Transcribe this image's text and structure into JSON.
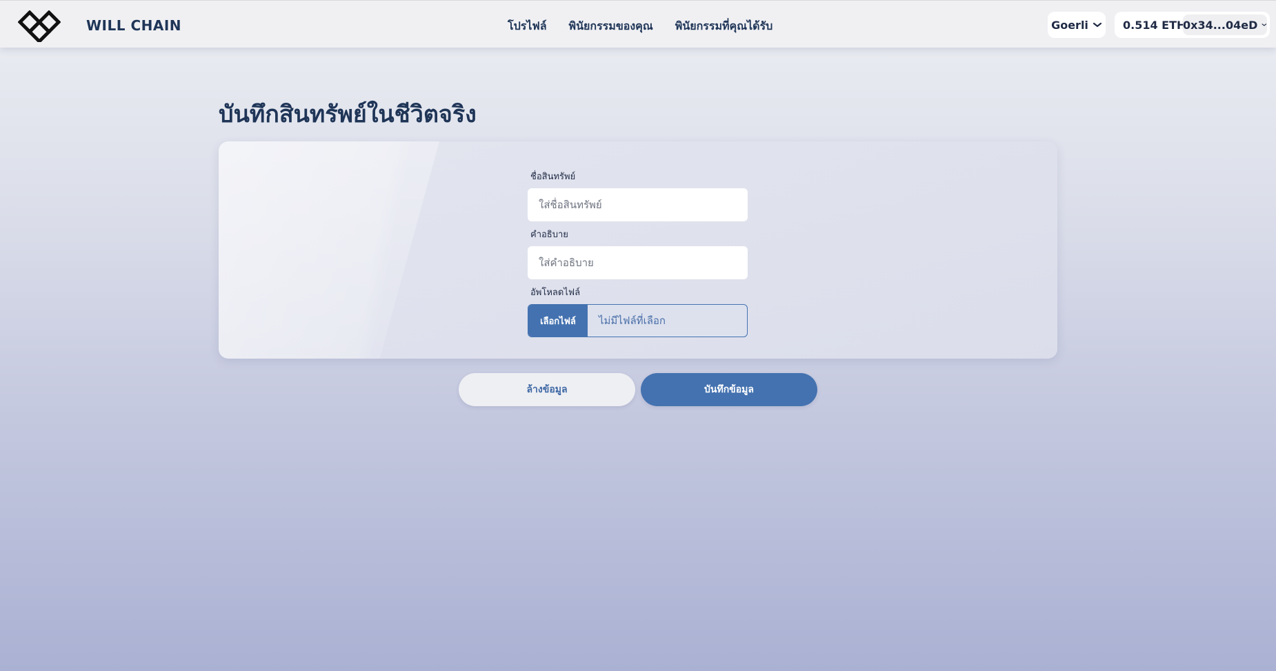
{
  "header": {
    "brand": "WILL CHAIN",
    "nav": [
      {
        "label": "โปรไฟล์"
      },
      {
        "label": "พินัยกรรมของคุณ"
      },
      {
        "label": "พินัยกรรมที่คุณได้รับ"
      }
    ],
    "network": "Goerli",
    "balance": "0.514 ETH",
    "account": "0x34...04eD"
  },
  "page": {
    "title": "บันทึกสินทรัพย์ในชีวิตจริง"
  },
  "form": {
    "name_label": "ชื่อสินทรัพย์",
    "name_placeholder": "ใส่ชื่อสินทรัพย์",
    "description_label": "คำอธิบาย",
    "description_placeholder": "ใส่คำอธิบาย",
    "upload_label": "อัพโหลดไฟล์",
    "file_button": "เลือกไฟล์",
    "file_status": "ไม่มีไฟล์ที่เลือก"
  },
  "actions": {
    "clear": "ล้างข้อมูล",
    "save": "บันทึกข้อมูล"
  },
  "colors": {
    "primary": "#4472b0",
    "heading": "#1f3557",
    "header_bg": "#f0f0f3"
  },
  "icons": {
    "logo": "will-chain-logo",
    "network_chevron": "chevron-down-icon",
    "account_chevron": "chevron-down-icon"
  }
}
